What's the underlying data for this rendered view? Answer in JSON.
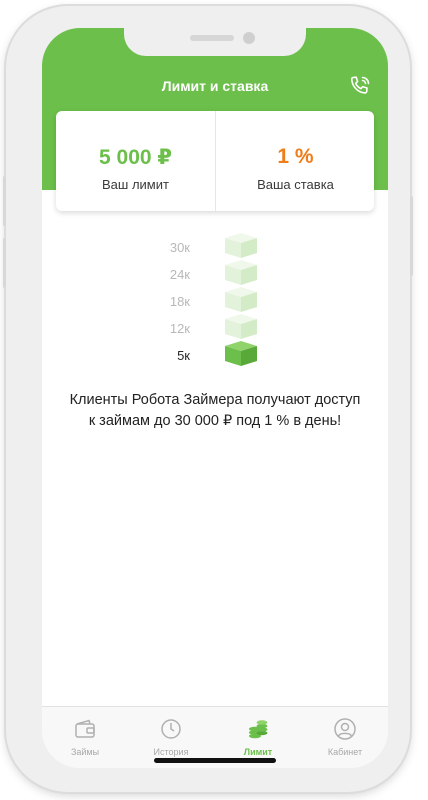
{
  "header": {
    "title": "Лимит и ставка",
    "call_icon": "phone-call-icon"
  },
  "summary": {
    "limit_value": "5 000 ₽",
    "limit_label": "Ваш лимит",
    "rate_value": "1 %",
    "rate_label": "Ваша ставка"
  },
  "scale": {
    "levels": [
      "30к",
      "24к",
      "18к",
      "12к",
      "5к"
    ],
    "active": "5к"
  },
  "description": [
    "Клиенты Робота Займера получают доступ",
    "к займам до 30 000 ₽ под 1 % в день!"
  ],
  "tabs": [
    {
      "label": "Займы",
      "icon": "wallet-icon"
    },
    {
      "label": "История",
      "icon": "clock-icon"
    },
    {
      "label": "Лимит",
      "icon": "coins-icon"
    },
    {
      "label": "Кабинет",
      "icon": "user-icon"
    }
  ],
  "active_tab": "Лимит",
  "colors": {
    "accent": "#6cbf4a",
    "rate": "#ef7d1a",
    "cube_inactive": "#e4f3dc"
  }
}
